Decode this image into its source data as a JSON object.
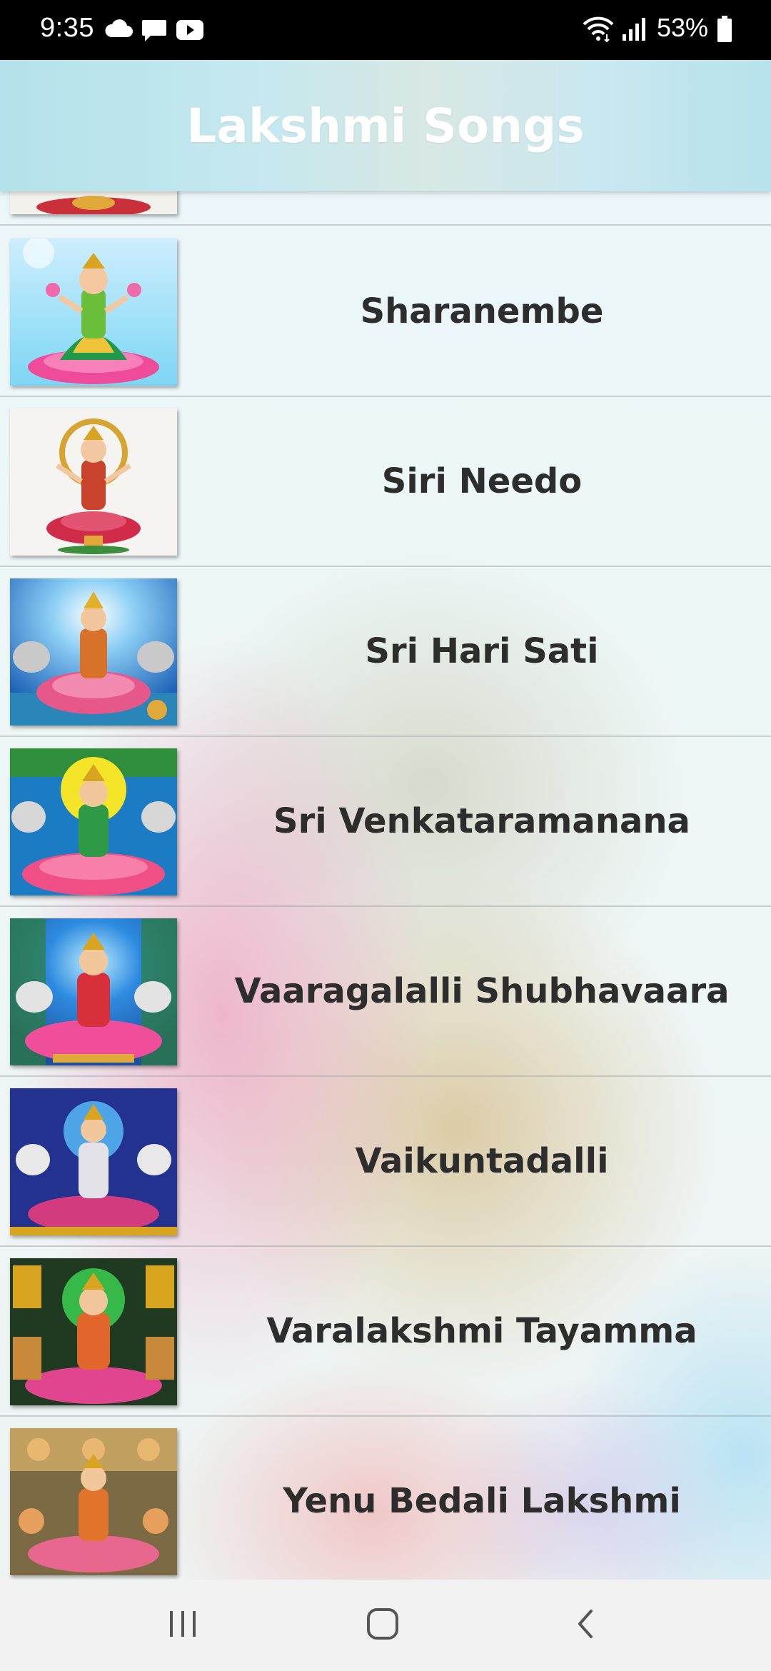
{
  "status_bar": {
    "time": "9:35",
    "battery_percent": "53%",
    "icons": [
      "cloud-icon",
      "message-icon",
      "youtube-icon",
      "wifi-icon",
      "signal-icon",
      "battery-icon"
    ]
  },
  "app_bar": {
    "title": "Lakshmi Songs",
    "gradient_colors": [
      "#b5e2ec",
      "#d8e8e4"
    ]
  },
  "songs": [
    {
      "title": ""
    },
    {
      "title": "Sharanembe"
    },
    {
      "title": "Siri Needo"
    },
    {
      "title": "Sri Hari Sati"
    },
    {
      "title": "Sri Venkataramanana"
    },
    {
      "title": "Vaaragalalli Shubhavaara"
    },
    {
      "title": "Vaikuntadalli"
    },
    {
      "title": "Varalakshmi Tayamma"
    },
    {
      "title": "Yenu Bedali Lakshmi"
    }
  ],
  "nav_bar": {
    "icons": [
      "recent-apps-icon",
      "home-icon",
      "back-icon"
    ]
  }
}
